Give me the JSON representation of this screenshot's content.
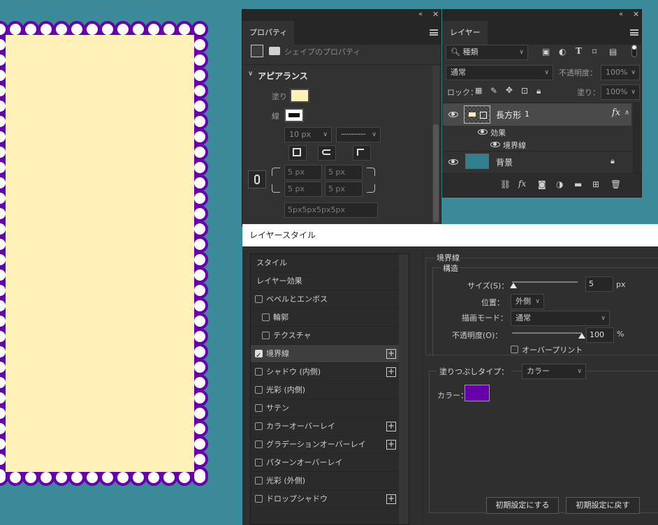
{
  "canvas": {
    "fill_color": "#fff1b8",
    "stroke_color": "#6600aa",
    "dot_color": "#ffffff"
  },
  "properties": {
    "tab": "プロパティ",
    "subtitle": "シェイプのプロパティ",
    "section": "アピアランス",
    "fill_label": "塗り",
    "fill_color": "#fff1b8",
    "stroke_label": "線",
    "stroke_width": "10 px",
    "corner_tl": "5 px",
    "corner_tr": "5 px",
    "corner_bl": "5 px",
    "corner_br": "5 px",
    "corner_summary": "5px5px5px5px"
  },
  "layers": {
    "tab": "レイヤー",
    "filter_kind": "種類",
    "blend_mode": "通常",
    "opacity_label": "不透明度：",
    "opacity_value": "100%",
    "lock_label": "ロック：",
    "fill_label": "塗り：",
    "fill_value": "100%",
    "rows": [
      {
        "name": "長方形",
        "suffix": "1",
        "fx": "fx"
      },
      {
        "name": "効果"
      },
      {
        "name": "境界線"
      },
      {
        "name": "背景"
      }
    ],
    "bg_thumb_color": "#2f7f8f"
  },
  "layer_style": {
    "title": "レイヤースタイル",
    "styles_header": "スタイル",
    "effects_header": "レイヤー効果",
    "items": [
      {
        "label": "ベベルとエンボス",
        "checked": false,
        "plus": false,
        "indent": false
      },
      {
        "label": "輪郭",
        "checked": false,
        "plus": false,
        "indent": true
      },
      {
        "label": "テクスチャ",
        "checked": false,
        "plus": false,
        "indent": true
      },
      {
        "label": "境界線",
        "checked": true,
        "plus": true,
        "indent": false
      },
      {
        "label": "シャドウ (内側)",
        "checked": false,
        "plus": true,
        "indent": false
      },
      {
        "label": "光彩 (内側)",
        "checked": false,
        "plus": false,
        "indent": false
      },
      {
        "label": "サテン",
        "checked": false,
        "plus": false,
        "indent": false
      },
      {
        "label": "カラーオーバーレイ",
        "checked": false,
        "plus": true,
        "indent": false
      },
      {
        "label": "グラデーションオーバーレイ",
        "checked": false,
        "plus": true,
        "indent": false
      },
      {
        "label": "パターンオーバーレイ",
        "checked": false,
        "plus": false,
        "indent": false
      },
      {
        "label": "光彩 (外側)",
        "checked": false,
        "plus": false,
        "indent": false
      },
      {
        "label": "ドロップシャドウ",
        "checked": false,
        "plus": true,
        "indent": false
      }
    ],
    "stroke": {
      "group_title": "境界線",
      "structure_title": "構造",
      "size_label": "サイズ(S)：",
      "size_value": "5",
      "size_unit": "px",
      "size_slider": 0.02,
      "position_label": "位置：",
      "position_value": "外側",
      "blend_label": "描画モード：",
      "blend_value": "通常",
      "opacity_label": "不透明度(O)：",
      "opacity_value": "100",
      "opacity_unit": "%",
      "opacity_slider": 1.0,
      "overprint_label": "オーバープリント",
      "fill_type_label": "塗りつぶしタイプ：",
      "fill_type_value": "カラー",
      "color_label": "カラー：",
      "color_value": "#6600aa",
      "default_set": "初期設定にする",
      "default_reset": "初期設定に戻す"
    }
  }
}
